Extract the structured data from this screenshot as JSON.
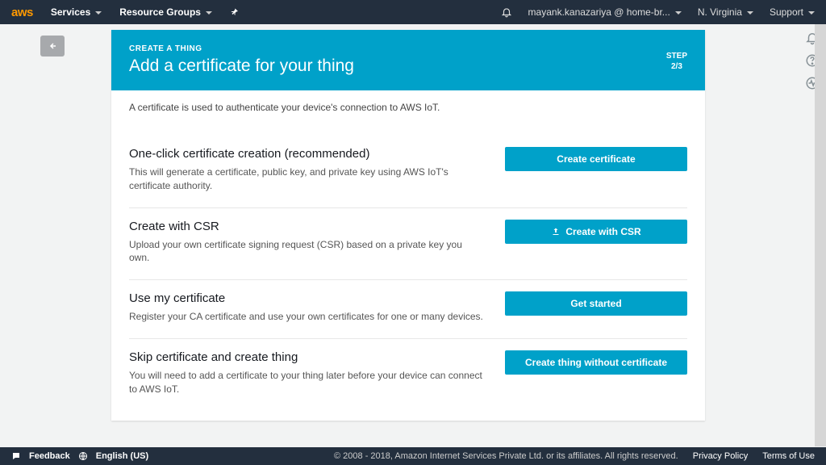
{
  "topnav": {
    "logo": "aws",
    "services": "Services",
    "resourceGroups": "Resource Groups",
    "user": "mayank.kanazariya @ home-br...",
    "region": "N. Virginia",
    "support": "Support"
  },
  "header": {
    "super": "CREATE A THING",
    "title": "Add a certificate for your thing",
    "stepLabel": "STEP",
    "stepValue": "2/3"
  },
  "intro": "A certificate is used to authenticate your device's connection to AWS IoT.",
  "sections": {
    "oneClick": {
      "title": "One-click certificate creation (recommended)",
      "desc": "This will generate a certificate, public key, and private key using AWS IoT's certificate authority.",
      "button": "Create certificate"
    },
    "csr": {
      "title": "Create with CSR",
      "desc": "Upload your own certificate signing request (CSR) based on a private key you own.",
      "button": "Create with CSR"
    },
    "myCert": {
      "title": "Use my certificate",
      "desc": "Register your CA certificate and use your own certificates for one or many devices.",
      "button": "Get started"
    },
    "skip": {
      "title": "Skip certificate and create thing",
      "desc": "You will need to add a certificate to your thing later before your device can connect to AWS IoT.",
      "button": "Create thing without certificate"
    }
  },
  "footer": {
    "feedback": "Feedback",
    "language": "English (US)",
    "legal": "© 2008 - 2018, Amazon Internet Services Private Ltd. or its affiliates. All rights reserved.",
    "privacy": "Privacy Policy",
    "terms": "Terms of Use"
  }
}
